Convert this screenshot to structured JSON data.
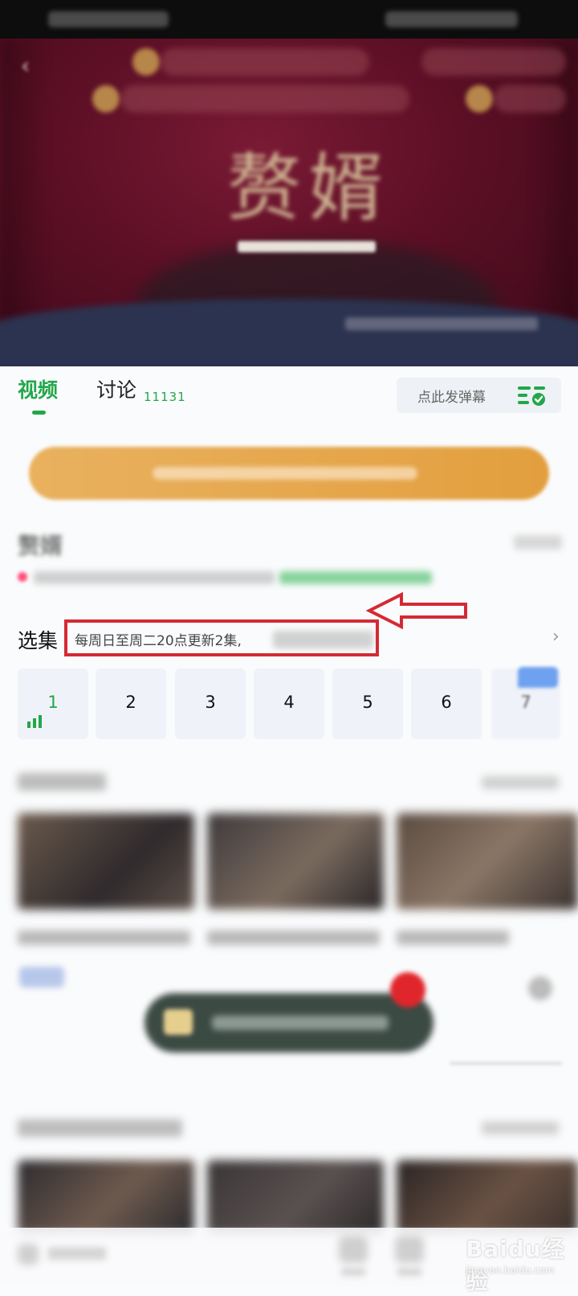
{
  "tabs": {
    "video_label": "视频",
    "discussion_label": "讨论",
    "discussion_count": "11131",
    "danmaku_placeholder": "点此发弹幕"
  },
  "show": {
    "title_art": "赘婿",
    "name": "赘婿"
  },
  "episode_selector": {
    "title": "选集",
    "schedule": "每周日至周二20点更新2集,",
    "episodes": [
      "1",
      "2",
      "3",
      "4",
      "5",
      "6",
      "7"
    ],
    "current_episode": "1"
  },
  "watermark": {
    "brand": "Baidu经验",
    "url": "jingyan.baidu.com"
  },
  "colors": {
    "accent_green": "#22a749",
    "highlight_red": "#d42a34",
    "vip_orange": "#e6a94e"
  }
}
